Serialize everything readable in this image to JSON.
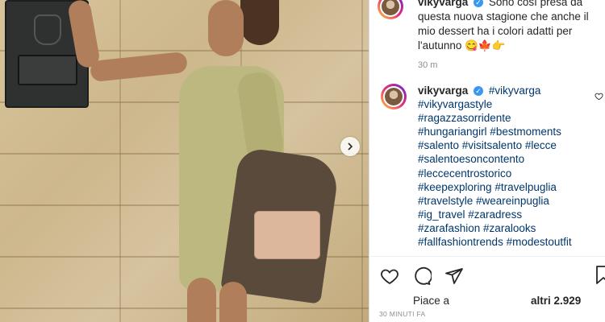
{
  "post": {
    "caption_user": "vikyvarga",
    "caption_text": "Sono così presa da questa nuova stagione che anche il mio dessert ha i colori adatti per l'autunno 😋🍁👉",
    "caption_time": "30 m",
    "comment_user": "vikyvarga",
    "comment_tags": [
      "#vikyvarga",
      "#vikyvargastyle",
      "#ragazzasorridente",
      "#hungariangirl #bestmoments",
      "#salento #visitsalento #lecce",
      "#salentoesoncontento",
      "#leccecentrostorico",
      "#keepexploring #travelpuglia",
      "#travelstyle #weareinpuglia",
      "#ig_travel #zaradress",
      "#zarafashion #zaralooks",
      "#fallfashiontrends #modestoutfit"
    ],
    "likes_prefix": "Piace a",
    "likes_suffix": "altri 2.929",
    "post_time": "30 minuti fa"
  },
  "icons": {
    "like": "heart-icon",
    "comment": "comment-icon",
    "share": "send-icon",
    "save": "bookmark-icon",
    "next": "chevron-right-icon",
    "verified": "verified-badge-icon",
    "comment_like": "heart-icon"
  },
  "colors": {
    "hashtag": "#00376b",
    "text": "#262626",
    "muted": "#8e8e8e",
    "verified": "#3897f0"
  }
}
